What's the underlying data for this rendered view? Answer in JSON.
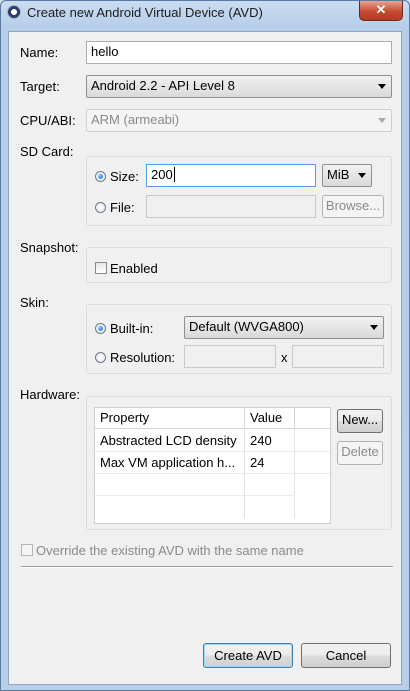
{
  "window": {
    "title": "Create new Android Virtual Device (AVD)",
    "close_glyph": "✕"
  },
  "form": {
    "name_label": "Name:",
    "name_value": "hello",
    "target_label": "Target:",
    "target_value": "Android 2.2 - API Level 8",
    "cpu_label": "CPU/ABI:",
    "cpu_value": "ARM (armeabi)",
    "sdcard_label": "SD Card:",
    "size_label": "Size:",
    "size_value": "200",
    "size_unit": "MiB",
    "file_label": "File:",
    "file_value": "",
    "browse_label": "Browse...",
    "snapshot_label": "Snapshot:",
    "enabled_label": "Enabled",
    "skin_label": "Skin:",
    "builtin_label": "Built-in:",
    "builtin_value": "Default (WVGA800)",
    "resolution_label": "Resolution:",
    "resolution_x": "x",
    "hardware_label": "Hardware:",
    "override_label": "Override the existing AVD with the same name"
  },
  "hardware": {
    "columns": [
      "Property",
      "Value"
    ],
    "rows": [
      {
        "property": "Abstracted LCD density",
        "value": "240"
      },
      {
        "property": "Max VM application h...",
        "value": "24"
      }
    ],
    "new_label": "New...",
    "delete_label": "Delete"
  },
  "footer": {
    "create_label": "Create AVD",
    "cancel_label": "Cancel"
  }
}
